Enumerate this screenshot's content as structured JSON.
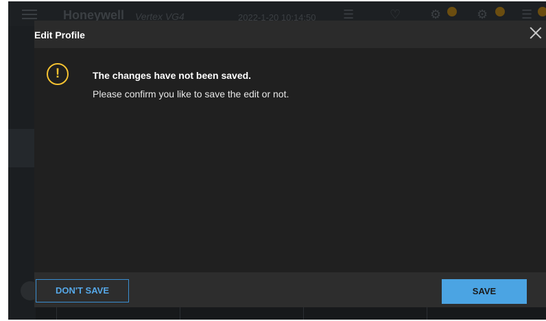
{
  "background_app": {
    "brand": "Honeywell",
    "model": "Vertex VG4",
    "datetime": "2022-1-20 10:14:50",
    "icons": [
      "list-status-icon",
      "bell-icon",
      "wrench-icon",
      "gear-icon",
      "alarm-list-icon"
    ]
  },
  "dialog": {
    "title": "Edit Profile",
    "close_icon": "close-icon",
    "warning_icon": "warning-icon",
    "warning_glyph": "!",
    "message_title": "The changes have not been saved.",
    "message_text": "Please confirm you like to save the edit or not.",
    "dont_save_label": "DON'T SAVE",
    "save_label": "SAVE"
  },
  "colors": {
    "accent": "#4ba4e3",
    "warning": "#f7c331",
    "dialog_body": "#202020",
    "dialog_frame": "#2d2d2d"
  }
}
